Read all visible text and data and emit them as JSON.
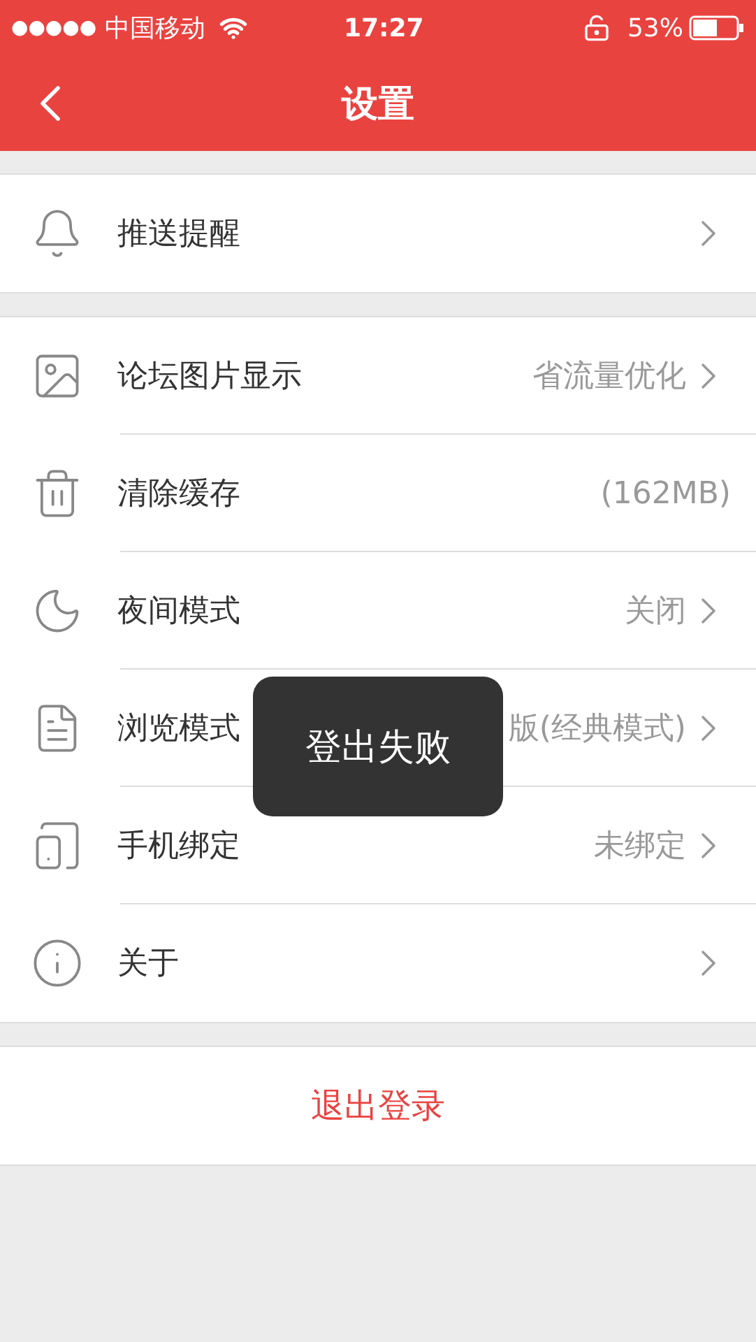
{
  "status_bar": {
    "signal_dots": "●●●●●",
    "carrier": "中国移动",
    "time": "17:27",
    "battery": "53%"
  },
  "nav": {
    "title": "设置"
  },
  "groups": [
    {
      "rows": [
        {
          "kind": "bell",
          "label": "推送提醒",
          "chevron": true
        }
      ]
    },
    {
      "rows": [
        {
          "kind": "image",
          "label": "论坛图片显示",
          "value": "省流量优化",
          "chevron": true
        },
        {
          "kind": "trash",
          "label": "清除缓存",
          "value": "(162MB)",
          "chevron": false
        },
        {
          "kind": "moon",
          "label": "夜间模式",
          "value": "关闭",
          "chevron": true
        },
        {
          "kind": "document",
          "label": "浏览模式",
          "value": "版(经典模式)",
          "chevron": true
        },
        {
          "kind": "phone",
          "label": "手机绑定",
          "value": "未绑定",
          "chevron": true
        },
        {
          "kind": "info",
          "label": "关于",
          "chevron": true
        }
      ]
    }
  ],
  "logout": {
    "label": "退出登录"
  },
  "toast": {
    "text": "登出失败"
  }
}
